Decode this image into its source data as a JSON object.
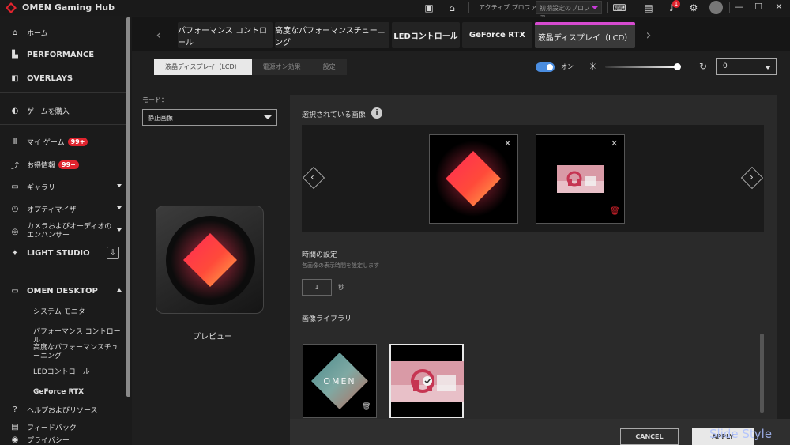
{
  "app": {
    "title": "OMEN Gaming Hub"
  },
  "titlebar": {
    "profile_label": "アクティブ プロファイル",
    "profile_value": "初期設定のプロファ...",
    "notification_count": "1"
  },
  "sidebar": {
    "home": "ホーム",
    "performance": "PERFORMANCE",
    "overlays": "OVERLAYS",
    "buy_games": "ゲームを購入",
    "my_games": "マイ ゲーム",
    "my_games_badge": "99+",
    "deals": "お得情報",
    "deals_badge": "99+",
    "gallery": "ギャラリー",
    "optimizer": "オプティマイザー",
    "camera_audio": "カメラおよびオーディオのエンハンサー",
    "light_studio": "LIGHT STUDIO",
    "omen_desktop": "OMEN DESKTOP",
    "sub_items": [
      "システム モニター",
      "パフォーマンス コントロール",
      "高度なパフォーマンスチューニング",
      "LEDコントロール",
      "GeForce RTX"
    ],
    "help": "ヘルプおよびリソース",
    "feedback": "フィードバック",
    "privacy": "プライバシー"
  },
  "tabs": [
    "パフォーマンス コントロール",
    "高度なパフォーマンスチューニング",
    "LEDコントロール",
    "GeForce RTX",
    "液晶ディスプレイ（LCD）"
  ],
  "subtabs": [
    "液晶ディスプレイ（LCD）",
    "電源オン効果",
    "設定"
  ],
  "controls": {
    "toggle_label": "オン",
    "toggle_on": true,
    "brightness": 1.0,
    "number_value": "0"
  },
  "mode": {
    "label": "モード：",
    "value": "静止画像"
  },
  "preview": {
    "label": "プレビュー"
  },
  "selected": {
    "title": "選択されている画像"
  },
  "time": {
    "title": "時間の設定",
    "subtitle": "各画像の表示時間を設定します",
    "value": "1",
    "unit": "秒"
  },
  "library": {
    "title": "画像ライブラリ",
    "logo_text": "OMEN"
  },
  "buttons": {
    "cancel": "CANCEL",
    "apply": "APPLY"
  },
  "watermark": "Slide Style",
  "colors": {
    "accent": "#d64bd0",
    "badge": "#e0242e",
    "toggle": "#4a8de0"
  }
}
